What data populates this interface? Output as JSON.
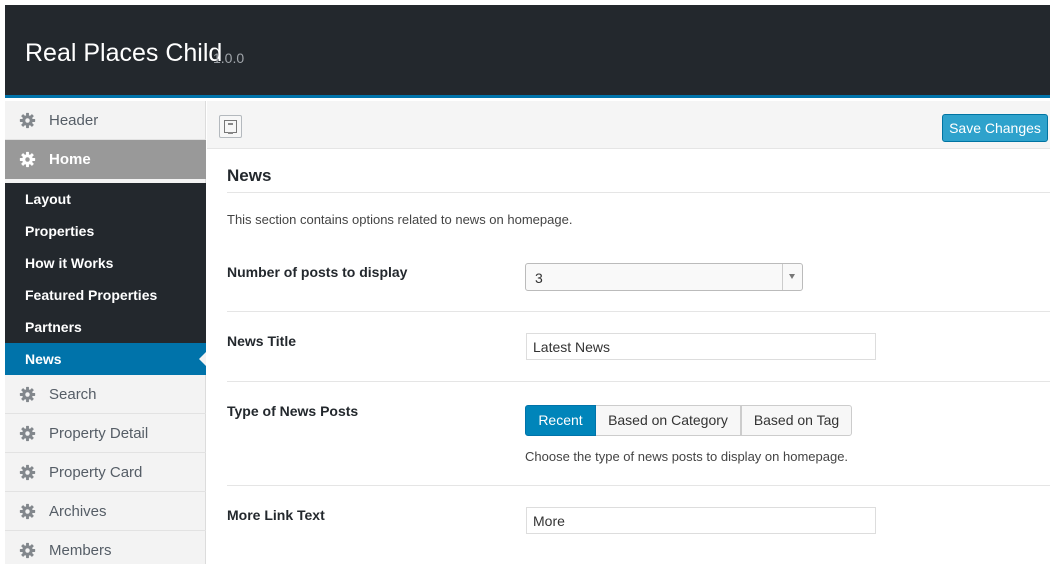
{
  "app": {
    "title": "Real Places Child",
    "version": "1.0.0"
  },
  "sidebar": {
    "items": [
      {
        "label": "Header",
        "icon": "gear-icon"
      },
      {
        "label": "Home",
        "icon": "gear-icon",
        "active": true
      },
      {
        "label": "Search",
        "icon": "gear-icon"
      },
      {
        "label": "Property Detail",
        "icon": "gear-icon"
      },
      {
        "label": "Property Card",
        "icon": "gear-icon"
      },
      {
        "label": "Archives",
        "icon": "gear-icon"
      },
      {
        "label": "Members",
        "icon": "gear-icon"
      }
    ],
    "subitems": [
      {
        "label": "Layout"
      },
      {
        "label": "Properties"
      },
      {
        "label": "How it Works"
      },
      {
        "label": "Featured Properties"
      },
      {
        "label": "Partners"
      },
      {
        "label": "News",
        "current": true
      }
    ]
  },
  "toolbar": {
    "layout_icon": "layout-toggle-icon",
    "save_label": "Save Changes"
  },
  "section": {
    "title": "News",
    "description": "This section contains options related to news on homepage.",
    "fields": {
      "num_posts": {
        "label": "Number of posts to display",
        "value": "3"
      },
      "news_title": {
        "label": "News Title",
        "value": "Latest News"
      },
      "news_type": {
        "label": "Type of News Posts",
        "options": [
          "Recent",
          "Based on Category",
          "Based on Tag"
        ],
        "selected": "Recent",
        "help": "Choose the type of news posts to display on homepage."
      },
      "more_link": {
        "label": "More Link Text",
        "value": "More"
      }
    }
  },
  "colors": {
    "topbar": "#23282d",
    "accent": "#0073aa",
    "primary_button": "#2ea2cc"
  }
}
